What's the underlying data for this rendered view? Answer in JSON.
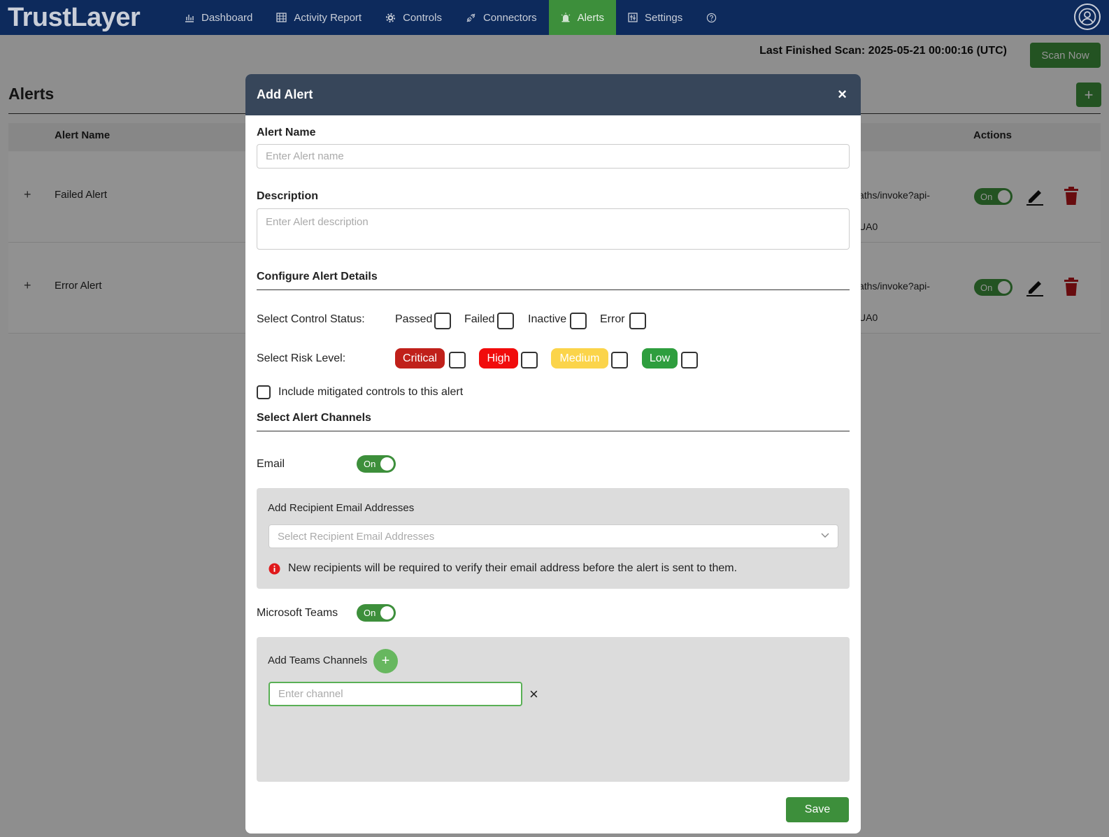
{
  "app": {
    "logo": "TrustLayer"
  },
  "nav": {
    "items": [
      {
        "label": "Dashboard",
        "icon": "bar-chart-icon"
      },
      {
        "label": "Activity Report",
        "icon": "table-icon"
      },
      {
        "label": "Controls",
        "icon": "gear-icon"
      },
      {
        "label": "Connectors",
        "icon": "plug-icon"
      },
      {
        "label": "Alerts",
        "icon": "alarm-icon",
        "active": true
      },
      {
        "label": "Settings",
        "icon": "grid-icon"
      }
    ],
    "help_icon": "help-icon",
    "avatar_icon": "user-icon"
  },
  "page": {
    "scan_text": "Last Finished Scan: 2025-05-21 00:00:16 (UTC)",
    "scan_button": "Scan Now",
    "title": "Alerts",
    "add_button": "+",
    "table": {
      "headers": {
        "name": "Alert Name",
        "actions": "Actions"
      },
      "rows": [
        {
          "expand": "+",
          "name": "Failed Alert",
          "url": "aths/invoke?api-",
          "url2": "UA0",
          "toggle": "On"
        },
        {
          "expand": "+",
          "name": "Error Alert",
          "url": "aths/invoke?api-",
          "url2": "UA0",
          "toggle": "On"
        }
      ]
    }
  },
  "modal": {
    "title": "Add Alert",
    "close": "×",
    "alert_name": {
      "label": "Alert Name",
      "placeholder": "Enter Alert name"
    },
    "description": {
      "label": "Description",
      "placeholder": "Enter Alert description"
    },
    "config_title": "Configure Alert Details",
    "control_status": {
      "label": "Select Control Status:",
      "options": [
        "Passed",
        "Failed",
        "Inactive",
        "Error"
      ]
    },
    "risk_level": {
      "label": "Select Risk Level:",
      "options": [
        {
          "label": "Critical",
          "color": "#c0201a"
        },
        {
          "label": "High",
          "color": "#f10c0c"
        },
        {
          "label": "Medium",
          "color": "#fbd44a"
        },
        {
          "label": "Low",
          "color": "#2e9e3e"
        }
      ]
    },
    "mitigated": "Include mitigated controls to this alert",
    "channels_title": "Select Alert Channels",
    "email": {
      "label": "Email",
      "toggle": "On",
      "panel_label": "Add Recipient Email Addresses",
      "select_placeholder": "Select Recipient Email Addresses",
      "info": "New recipients will be required to verify their email address before the alert is sent to them."
    },
    "teams": {
      "label": "Microsoft Teams",
      "toggle": "On",
      "panel_label": "Add Teams Channels",
      "add": "+",
      "channel_placeholder": "Enter channel",
      "remove": "×"
    },
    "save": "Save"
  }
}
